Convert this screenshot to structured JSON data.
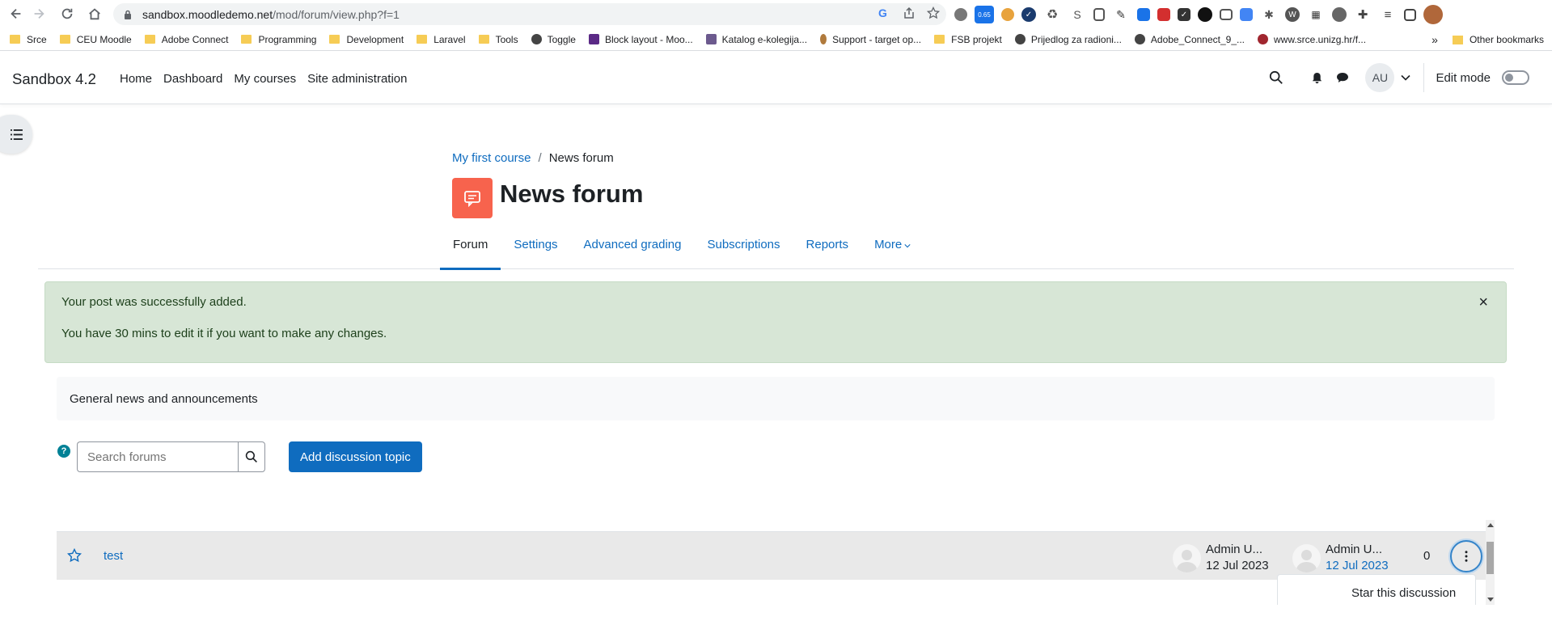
{
  "browser": {
    "url_host": "sandbox.moodledemo.net",
    "url_path": "/mod/forum/view.php?f=1",
    "extension_badge": "0.65",
    "bookmarks": [
      "Srce",
      "CEU Moodle",
      "Adobe Connect",
      "Programming",
      "Development",
      "Laravel",
      "Tools",
      "Toggle",
      "Block layout - Moo...",
      "Katalog e-kolegija...",
      "Support - target op...",
      "FSB projekt",
      "Prijedlog za radioni...",
      "Adobe_Connect_9_...",
      "www.srce.unizg.hr/f..."
    ],
    "bookmarks_overflow": "»",
    "other_bookmarks": "Other bookmarks"
  },
  "navbar": {
    "brand": "Sandbox 4.2",
    "links": [
      "Home",
      "Dashboard",
      "My courses",
      "Site administration"
    ],
    "user_initials": "AU",
    "edit_mode_label": "Edit mode"
  },
  "breadcrumb": {
    "course": "My first course",
    "separator": "/",
    "current": "News forum"
  },
  "page": {
    "title": "News forum",
    "accent": "#f7634d"
  },
  "tabs": [
    "Forum",
    "Settings",
    "Advanced grading",
    "Subscriptions",
    "Reports",
    "More"
  ],
  "alert": {
    "line1": "Your post was successfully added.",
    "line2": "You have 30 mins to edit it if you want to make any changes.",
    "close": "×"
  },
  "intro": "General news and announcements",
  "search": {
    "placeholder": "Search forums",
    "help": "?"
  },
  "add_discussion_label": "Add discussion topic",
  "discussion": {
    "title": "test",
    "started_by": "Admin U...",
    "started_date": "12 Jul 2023",
    "last_post_by": "Admin U...",
    "last_post_date": "12 Jul 2023",
    "replies": "0"
  },
  "action_menu": {
    "item": "Star this discussion"
  }
}
